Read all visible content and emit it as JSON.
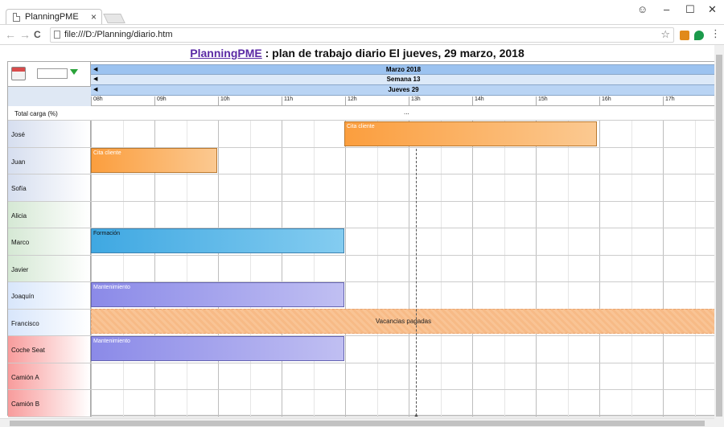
{
  "browser": {
    "tab_title": "PlanningPME",
    "tab_close": "×",
    "url": "file:///D:/Planning/diario.htm",
    "back": "←",
    "forward": "→",
    "reload": "C",
    "star": "☆",
    "menu": "⋮",
    "window_profile": "☺",
    "window_minimize": "–",
    "window_maximize": "☐",
    "window_close": "✕"
  },
  "page": {
    "title_link": "PlanningPME",
    "title_rest": " : plan de trabajo diario El jueves, 29 marzo, 2018"
  },
  "header": {
    "month": "Marzo 2018",
    "week": "Semana 13",
    "day": "Jueves 29",
    "arrow": "◀",
    "hours": [
      "08h",
      "09h",
      "10h",
      "11h",
      "12h",
      "13h",
      "14h",
      "15h",
      "16h",
      "17h"
    ]
  },
  "load": {
    "label": "Total carga (%)",
    "value": "..."
  },
  "resources": [
    {
      "name": "José",
      "color": "#d6deef"
    },
    {
      "name": "Juan",
      "color": "#d6deef"
    },
    {
      "name": "Sofía",
      "color": "#d6deef"
    },
    {
      "name": "Alicia",
      "color": "#d5e8d4"
    },
    {
      "name": "Marco",
      "color": "#d5e8d4"
    },
    {
      "name": "Javier",
      "color": "#d5e8d4"
    },
    {
      "name": "Joaquín",
      "color": "#d8e6fb"
    },
    {
      "name": "Francisco",
      "color": "#d8e6fb"
    },
    {
      "name": "Coche Seat",
      "color": "#f89c9c"
    },
    {
      "name": "Camión A",
      "color": "#f89c9c"
    },
    {
      "name": "Camión B",
      "color": "#f89c9c"
    }
  ],
  "tasks": {
    "jose": "Cita cliente",
    "juan": "Cita cliente",
    "marco": "Formación",
    "joaquin": "Mantenimiento",
    "francisco": "Vacancias pagadas",
    "francisco_marker": "...",
    "coche": "Mantenimiento"
  },
  "scroll": {
    "up": "▲"
  }
}
